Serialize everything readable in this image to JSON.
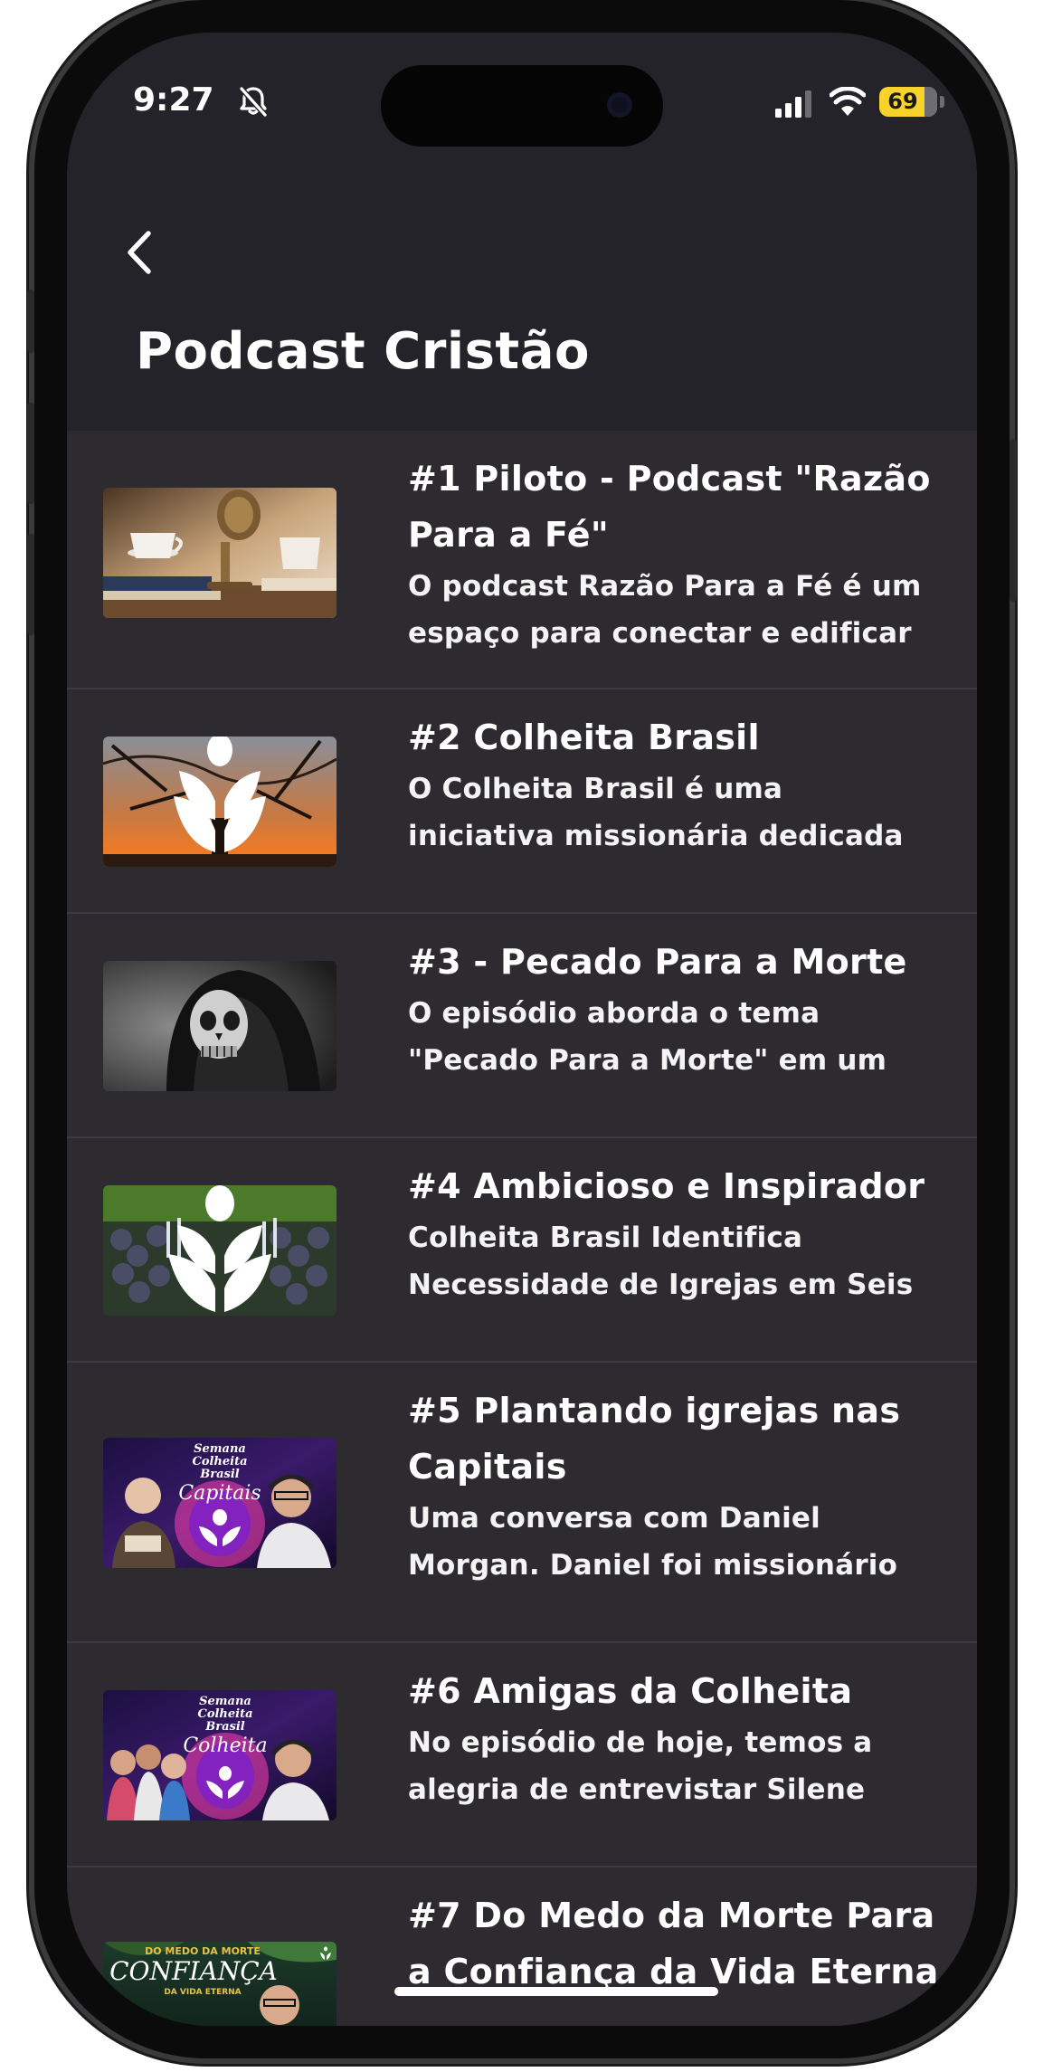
{
  "status_bar": {
    "time": "9:27",
    "battery": "69"
  },
  "header": {
    "title": "Podcast Cristão"
  },
  "episodes": [
    {
      "title_lines": [
        "#1 Piloto - Podcast \"Razão",
        "Para a Fé\""
      ],
      "desc_lines": [
        "O podcast Razão Para a Fé é um",
        "espaço para conectar e edificar"
      ]
    },
    {
      "title_lines": [
        "#2 Colheita Brasil"
      ],
      "desc_lines": [
        "O Colheita Brasil é uma",
        "iniciativa missionária dedicada"
      ]
    },
    {
      "title_lines": [
        "#3 - Pecado Para a Morte"
      ],
      "desc_lines": [
        "O episódio aborda o tema",
        "\"Pecado Para a Morte\" em um"
      ]
    },
    {
      "title_lines": [
        "#4 Ambicioso e Inspirador"
      ],
      "desc_lines": [
        "Colheita Brasil Identifica",
        "Necessidade de Igrejas em Seis"
      ]
    },
    {
      "title_lines": [
        "#5 Plantando igrejas nas",
        "Capitais"
      ],
      "desc_lines": [
        "Uma conversa com Daniel",
        "Morgan. Daniel foi missionário"
      ]
    },
    {
      "title_lines": [
        "#6 Amigas da Colheita"
      ],
      "desc_lines": [
        "No episódio de hoje, temos a",
        "alegria de entrevistar Silene"
      ]
    },
    {
      "title_lines": [
        "#7 Do Medo da Morte Para",
        "a Confiança da Vida Eterna"
      ],
      "desc_lines": []
    }
  ],
  "thumb_texts": {
    "ep5": [
      "Semana",
      "Colheita",
      "Brasil",
      "Capitais"
    ],
    "ep6": [
      "Semana",
      "Colheita",
      "Brasil",
      "Colheita"
    ],
    "ep7": [
      "DO MEDO DA MORTE",
      "CONFIANÇA",
      "DA VIDA ETERNA"
    ]
  }
}
